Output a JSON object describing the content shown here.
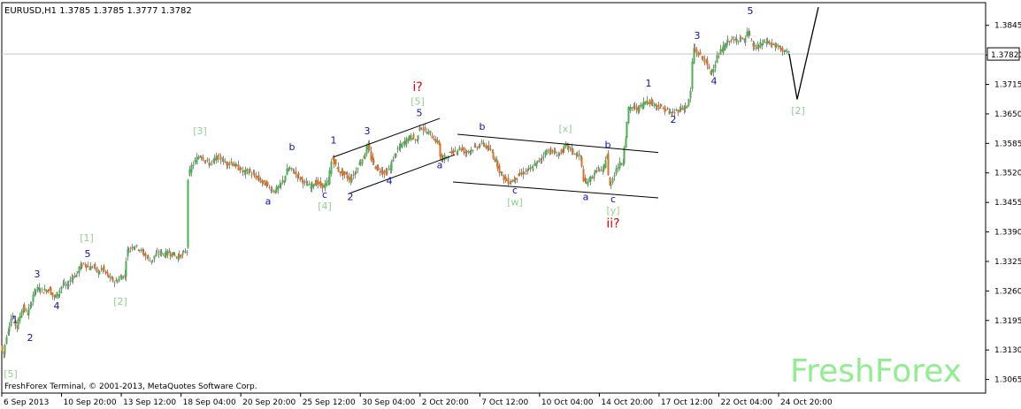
{
  "header": {
    "text": "EURUSD,H1  1.3785 1.3785 1.3777 1.3782"
  },
  "footer": {
    "copyright": "FreshForex Terminal, © 2001-2013, MetaQuotes Software Corp."
  },
  "brand": {
    "watermark": "FreshForex"
  },
  "colors": {
    "bull": "#4caf50",
    "bear": "#e07020",
    "minor": "#1010b0",
    "major": "#90d090",
    "red": "#e00000",
    "line": "#000000"
  },
  "chart_data": {
    "type": "line",
    "ylim": [
      1.3035,
      1.3895
    ],
    "y_ticks": [
      "1.3845",
      "1.3780",
      "1.3715",
      "1.3650",
      "1.3585",
      "1.3520",
      "1.3455",
      "1.3390",
      "1.3325",
      "1.3260",
      "1.3195",
      "1.3130",
      "1.3065"
    ],
    "y_tick_values": [
      1.3845,
      1.378,
      1.3715,
      1.365,
      1.3585,
      1.352,
      1.3455,
      1.339,
      1.3325,
      1.326,
      1.3195,
      1.313,
      1.3065
    ],
    "current_price": {
      "value": 1.3782,
      "label": "1.3782"
    },
    "x_ticks": [
      "6 Sep 2013",
      "10 Sep 20:00",
      "13 Sep 12:00",
      "18 Sep 04:00",
      "20 Sep 20:00",
      "25 Sep 12:00",
      "30 Sep 04:00",
      "2 Oct 20:00",
      "7 Oct 12:00",
      "10 Oct 04:00",
      "14 Oct 20:00",
      "17 Oct 12:00",
      "22 Oct 04:00",
      "24 Oct 20:00"
    ],
    "price_path": [
      [
        0,
        1.314
      ],
      [
        3,
        1.312
      ],
      [
        8,
        1.3175
      ],
      [
        13,
        1.3205
      ],
      [
        18,
        1.318
      ],
      [
        25,
        1.3225
      ],
      [
        30,
        1.321
      ],
      [
        33,
        1.3225
      ],
      [
        38,
        1.326
      ],
      [
        43,
        1.3265
      ],
      [
        48,
        1.326
      ],
      [
        55,
        1.3265
      ],
      [
        60,
        1.3245
      ],
      [
        65,
        1.3255
      ],
      [
        70,
        1.3275
      ],
      [
        75,
        1.327
      ],
      [
        80,
        1.329
      ],
      [
        85,
        1.3295
      ],
      [
        90,
        1.3315
      ],
      [
        95,
        1.332
      ],
      [
        100,
        1.331
      ],
      [
        105,
        1.3315
      ],
      [
        110,
        1.33
      ],
      [
        115,
        1.331
      ],
      [
        120,
        1.3295
      ],
      [
        125,
        1.3285
      ],
      [
        130,
        1.328
      ],
      [
        135,
        1.329
      ],
      [
        140,
        1.3295
      ],
      [
        143,
        1.335
      ],
      [
        150,
        1.336
      ],
      [
        155,
        1.3355
      ],
      [
        160,
        1.3345
      ],
      [
        165,
        1.3335
      ],
      [
        170,
        1.3325
      ],
      [
        175,
        1.334
      ],
      [
        180,
        1.3345
      ],
      [
        185,
        1.334
      ],
      [
        190,
        1.3345
      ],
      [
        195,
        1.334
      ],
      [
        200,
        1.3335
      ],
      [
        205,
        1.334
      ],
      [
        210,
        1.335
      ],
      [
        212,
        1.351
      ],
      [
        216,
        1.3535
      ],
      [
        220,
        1.3545
      ],
      [
        225,
        1.356
      ],
      [
        230,
        1.355
      ],
      [
        235,
        1.354
      ],
      [
        240,
        1.3545
      ],
      [
        245,
        1.3555
      ],
      [
        250,
        1.355
      ],
      [
        255,
        1.354
      ],
      [
        260,
        1.3545
      ],
      [
        265,
        1.3535
      ],
      [
        270,
        1.353
      ],
      [
        275,
        1.352
      ],
      [
        280,
        1.3525
      ],
      [
        285,
        1.3515
      ],
      [
        290,
        1.351
      ],
      [
        295,
        1.35
      ],
      [
        300,
        1.3495
      ],
      [
        305,
        1.3485
      ],
      [
        310,
        1.348
      ],
      [
        315,
        1.349
      ],
      [
        320,
        1.3505
      ],
      [
        325,
        1.353
      ],
      [
        330,
        1.3525
      ],
      [
        335,
        1.3515
      ],
      [
        340,
        1.3505
      ],
      [
        345,
        1.3495
      ],
      [
        350,
        1.349
      ],
      [
        355,
        1.35
      ],
      [
        360,
        1.3495
      ],
      [
        365,
        1.349
      ],
      [
        370,
        1.35
      ],
      [
        375,
        1.3555
      ],
      [
        380,
        1.353
      ],
      [
        385,
        1.352
      ],
      [
        390,
        1.3515
      ],
      [
        395,
        1.3505
      ],
      [
        400,
        1.352
      ],
      [
        405,
        1.354
      ],
      [
        410,
        1.3555
      ],
      [
        415,
        1.358
      ],
      [
        420,
        1.3545
      ],
      [
        425,
        1.353
      ],
      [
        430,
        1.3525
      ],
      [
        435,
        1.352
      ],
      [
        440,
        1.353
      ],
      [
        445,
        1.356
      ],
      [
        450,
        1.3575
      ],
      [
        455,
        1.3585
      ],
      [
        460,
        1.3595
      ],
      [
        465,
        1.36
      ],
      [
        470,
        1.359
      ],
      [
        474,
        1.3625
      ],
      [
        478,
        1.3615
      ],
      [
        482,
        1.361
      ],
      [
        486,
        1.3605
      ],
      [
        490,
        1.3595
      ],
      [
        495,
        1.3585
      ],
      [
        498,
        1.3545
      ],
      [
        502,
        1.3555
      ],
      [
        506,
        1.356
      ],
      [
        510,
        1.3565
      ],
      [
        515,
        1.357
      ],
      [
        520,
        1.3575
      ],
      [
        525,
        1.3565
      ],
      [
        530,
        1.357
      ],
      [
        535,
        1.3575
      ],
      [
        540,
        1.358
      ],
      [
        545,
        1.3585
      ],
      [
        550,
        1.3575
      ],
      [
        555,
        1.3565
      ],
      [
        560,
        1.3545
      ],
      [
        565,
        1.352
      ],
      [
        570,
        1.3505
      ],
      [
        575,
        1.35
      ],
      [
        580,
        1.3505
      ],
      [
        585,
        1.3515
      ],
      [
        590,
        1.352
      ],
      [
        595,
        1.3525
      ],
      [
        600,
        1.353
      ],
      [
        605,
        1.354
      ],
      [
        610,
        1.355
      ],
      [
        615,
        1.3565
      ],
      [
        620,
        1.357
      ],
      [
        625,
        1.3565
      ],
      [
        630,
        1.356
      ],
      [
        635,
        1.357
      ],
      [
        640,
        1.358
      ],
      [
        645,
        1.357
      ],
      [
        650,
        1.356
      ],
      [
        655,
        1.3555
      ],
      [
        660,
        1.3495
      ],
      [
        665,
        1.3505
      ],
      [
        670,
        1.3515
      ],
      [
        675,
        1.353
      ],
      [
        680,
        1.352
      ],
      [
        685,
        1.356
      ],
      [
        688,
        1.349
      ],
      [
        692,
        1.351
      ],
      [
        696,
        1.353
      ],
      [
        700,
        1.354
      ],
      [
        703,
        1.3545
      ],
      [
        706,
        1.36
      ],
      [
        710,
        1.366
      ],
      [
        715,
        1.3665
      ],
      [
        720,
        1.366
      ],
      [
        725,
        1.367
      ],
      [
        730,
        1.368
      ],
      [
        735,
        1.3675
      ],
      [
        740,
        1.367
      ],
      [
        745,
        1.3665
      ],
      [
        750,
        1.366
      ],
      [
        755,
        1.3655
      ],
      [
        758,
        1.365
      ],
      [
        762,
        1.3655
      ],
      [
        767,
        1.366
      ],
      [
        772,
        1.3665
      ],
      [
        776,
        1.3665
      ],
      [
        780,
        1.37
      ],
      [
        783,
        1.3795
      ],
      [
        787,
        1.3785
      ],
      [
        792,
        1.3775
      ],
      [
        797,
        1.3765
      ],
      [
        802,
        1.374
      ],
      [
        806,
        1.3755
      ],
      [
        810,
        1.3775
      ],
      [
        815,
        1.379
      ],
      [
        820,
        1.3805
      ],
      [
        825,
        1.3815
      ],
      [
        830,
        1.381
      ],
      [
        835,
        1.382
      ],
      [
        840,
        1.381
      ],
      [
        845,
        1.383
      ],
      [
        850,
        1.38
      ],
      [
        855,
        1.3795
      ],
      [
        860,
        1.3805
      ],
      [
        865,
        1.381
      ],
      [
        870,
        1.3805
      ],
      [
        875,
        1.38
      ],
      [
        880,
        1.3795
      ],
      [
        885,
        1.379
      ],
      [
        890,
        1.3782
      ]
    ],
    "projection": [
      [
        890,
        1.3782
      ],
      [
        899,
        1.3682
      ],
      [
        923,
        1.3885
      ]
    ],
    "channels": [
      [
        [
          375,
          1.3555
        ],
        [
          495,
          1.364
        ]
      ],
      [
        [
          393,
          1.3475
        ],
        [
          512,
          1.356
        ]
      ],
      [
        [
          515,
          1.3605
        ],
        [
          742,
          1.3565
        ]
      ],
      [
        [
          510,
          1.35
        ],
        [
          742,
          1.3465
        ]
      ]
    ],
    "wave_labels": [
      {
        "text": "[5]",
        "x": 10,
        "y": 1.307,
        "style": "major"
      },
      {
        "text": "1",
        "x": 15,
        "y": 1.319,
        "style": "minor"
      },
      {
        "text": "2",
        "x": 32,
        "y": 1.315,
        "style": "minor"
      },
      {
        "text": "3",
        "x": 40,
        "y": 1.329,
        "style": "minor"
      },
      {
        "text": "4",
        "x": 62,
        "y": 1.322,
        "style": "minor"
      },
      {
        "text": "5",
        "x": 97,
        "y": 1.3335,
        "style": "minor"
      },
      {
        "text": "[1]",
        "x": 96,
        "y": 1.337,
        "style": "major"
      },
      {
        "text": "[2]",
        "x": 134,
        "y": 1.323,
        "style": "major"
      },
      {
        "text": "[3]",
        "x": 224,
        "y": 1.3605,
        "style": "major"
      },
      {
        "text": "a",
        "x": 301,
        "y": 1.345,
        "style": "minor"
      },
      {
        "text": "b",
        "x": 328,
        "y": 1.357,
        "style": "minor"
      },
      {
        "text": "c",
        "x": 365,
        "y": 1.3465,
        "style": "minor"
      },
      {
        "text": "[4]",
        "x": 365,
        "y": 1.344,
        "style": "major"
      },
      {
        "text": "1",
        "x": 375,
        "y": 1.3585,
        "style": "minor"
      },
      {
        "text": "2",
        "x": 394,
        "y": 1.346,
        "style": "minor"
      },
      {
        "text": "3",
        "x": 413,
        "y": 1.3605,
        "style": "minor"
      },
      {
        "text": "4",
        "x": 438,
        "y": 1.3495,
        "style": "minor"
      },
      {
        "text": "5",
        "x": 472,
        "y": 1.3645,
        "style": "minor"
      },
      {
        "text": "[5]",
        "x": 470,
        "y": 1.367,
        "style": "major"
      },
      {
        "text": "i?",
        "x": 470,
        "y": 1.37,
        "style": "red"
      },
      {
        "text": "a",
        "x": 495,
        "y": 1.353,
        "style": "minor"
      },
      {
        "text": "b",
        "x": 543,
        "y": 1.3615,
        "style": "minor"
      },
      {
        "text": "c",
        "x": 580,
        "y": 1.3475,
        "style": "minor"
      },
      {
        "text": "[w]",
        "x": 580,
        "y": 1.3448,
        "style": "major"
      },
      {
        "text": "[x]",
        "x": 637,
        "y": 1.361,
        "style": "major"
      },
      {
        "text": "a",
        "x": 660,
        "y": 1.346,
        "style": "minor"
      },
      {
        "text": "b",
        "x": 685,
        "y": 1.3575,
        "style": "minor"
      },
      {
        "text": "c",
        "x": 691,
        "y": 1.3455,
        "style": "minor"
      },
      {
        "text": "[y]",
        "x": 691,
        "y": 1.343,
        "style": "major"
      },
      {
        "text": "ii?",
        "x": 691,
        "y": 1.34,
        "style": "red"
      },
      {
        "text": "1",
        "x": 731,
        "y": 1.371,
        "style": "minor"
      },
      {
        "text": "2",
        "x": 759,
        "y": 1.363,
        "style": "minor"
      },
      {
        "text": "3",
        "x": 786,
        "y": 1.3815,
        "style": "minor"
      },
      {
        "text": "4",
        "x": 805,
        "y": 1.3715,
        "style": "minor"
      },
      {
        "text": "5",
        "x": 846,
        "y": 1.387,
        "style": "minor"
      },
      {
        "text": "[2]",
        "x": 900,
        "y": 1.365,
        "style": "major"
      }
    ]
  }
}
